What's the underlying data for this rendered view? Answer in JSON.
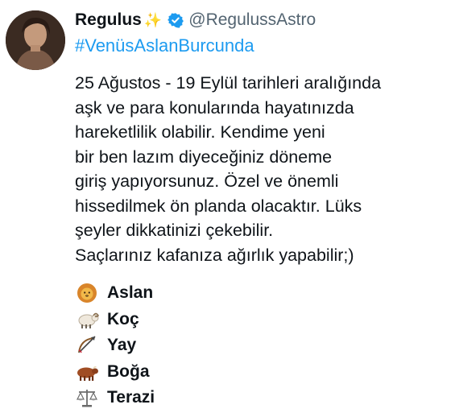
{
  "tweet": {
    "display_name": "Regulus",
    "sparkle": "✨",
    "handle": "@RegulussAstro",
    "hashtag": "#VenüsAslanBurcunda",
    "lines": [
      "25 Ağustos - 19 Eylül tarihleri aralığında",
      "aşk ve para konularında hayatınızda",
      "hareketlilik olabilir. Kendime yeni",
      "bir ben lazım diyeceğiniz döneme",
      "giriş yapıyorsunuz. Özel ve önemli",
      "hissedilmek ön planda olacaktır. Lüks",
      "şeyler dikkatinizi çekebilir.",
      "Saçlarınız kafanıza ağırlık yapabilir;)"
    ],
    "signs": [
      {
        "label": "Aslan",
        "icon": "lion-icon"
      },
      {
        "label": "Koç",
        "icon": "ram-icon"
      },
      {
        "label": "Yay",
        "icon": "bow-and-arrow-icon"
      },
      {
        "label": "Boğa",
        "icon": "ox-icon"
      },
      {
        "label": "Terazi",
        "icon": "scales-icon"
      }
    ]
  },
  "colors": {
    "link": "#1d9bf0",
    "verified": "#1d9bf0",
    "muted": "#536471",
    "text": "#0f1419"
  }
}
